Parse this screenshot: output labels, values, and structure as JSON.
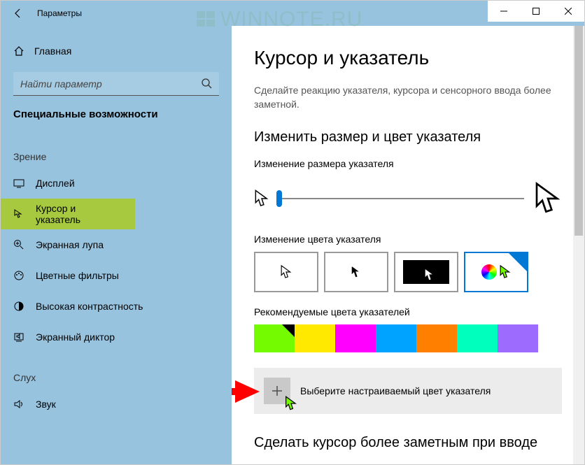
{
  "window": {
    "title": "Параметры"
  },
  "watermark": {
    "text": "WINNOTE.RU"
  },
  "sidebar": {
    "home_label": "Главная",
    "search_placeholder": "Найти параметр",
    "category_title": "Специальные возможности",
    "section_vision": "Зрение",
    "section_hearing": "Слух",
    "items_vision": [
      {
        "label": "Дисплей"
      },
      {
        "label": "Курсор и указатель",
        "selected": true
      },
      {
        "label": "Экранная лупа"
      },
      {
        "label": "Цветные фильтры"
      },
      {
        "label": "Высокая контрастность"
      },
      {
        "label": "Экранный диктор"
      }
    ],
    "items_hearing": [
      {
        "label": "Звук"
      }
    ]
  },
  "main": {
    "heading": "Курсор и указатель",
    "description": "Сделайте реакцию указателя, курсора и сенсорного ввода более заметной.",
    "section_size_color": "Изменить размер и цвет указателя",
    "size_label": "Изменение размера указателя",
    "color_label": "Изменение цвета указателя",
    "recommended_label": "Рекомендуемые цвета указателей",
    "recommended_colors": [
      "#74fb00",
      "#ffe900",
      "#ff00ff",
      "#00a3ff",
      "#ff7f00",
      "#00ffbc",
      "#9d6cff"
    ],
    "selected_color_index": 0,
    "custom_label": "Выберите настраиваемый цвет указателя",
    "section_cursor": "Сделать курсор более заметным при вводе"
  }
}
